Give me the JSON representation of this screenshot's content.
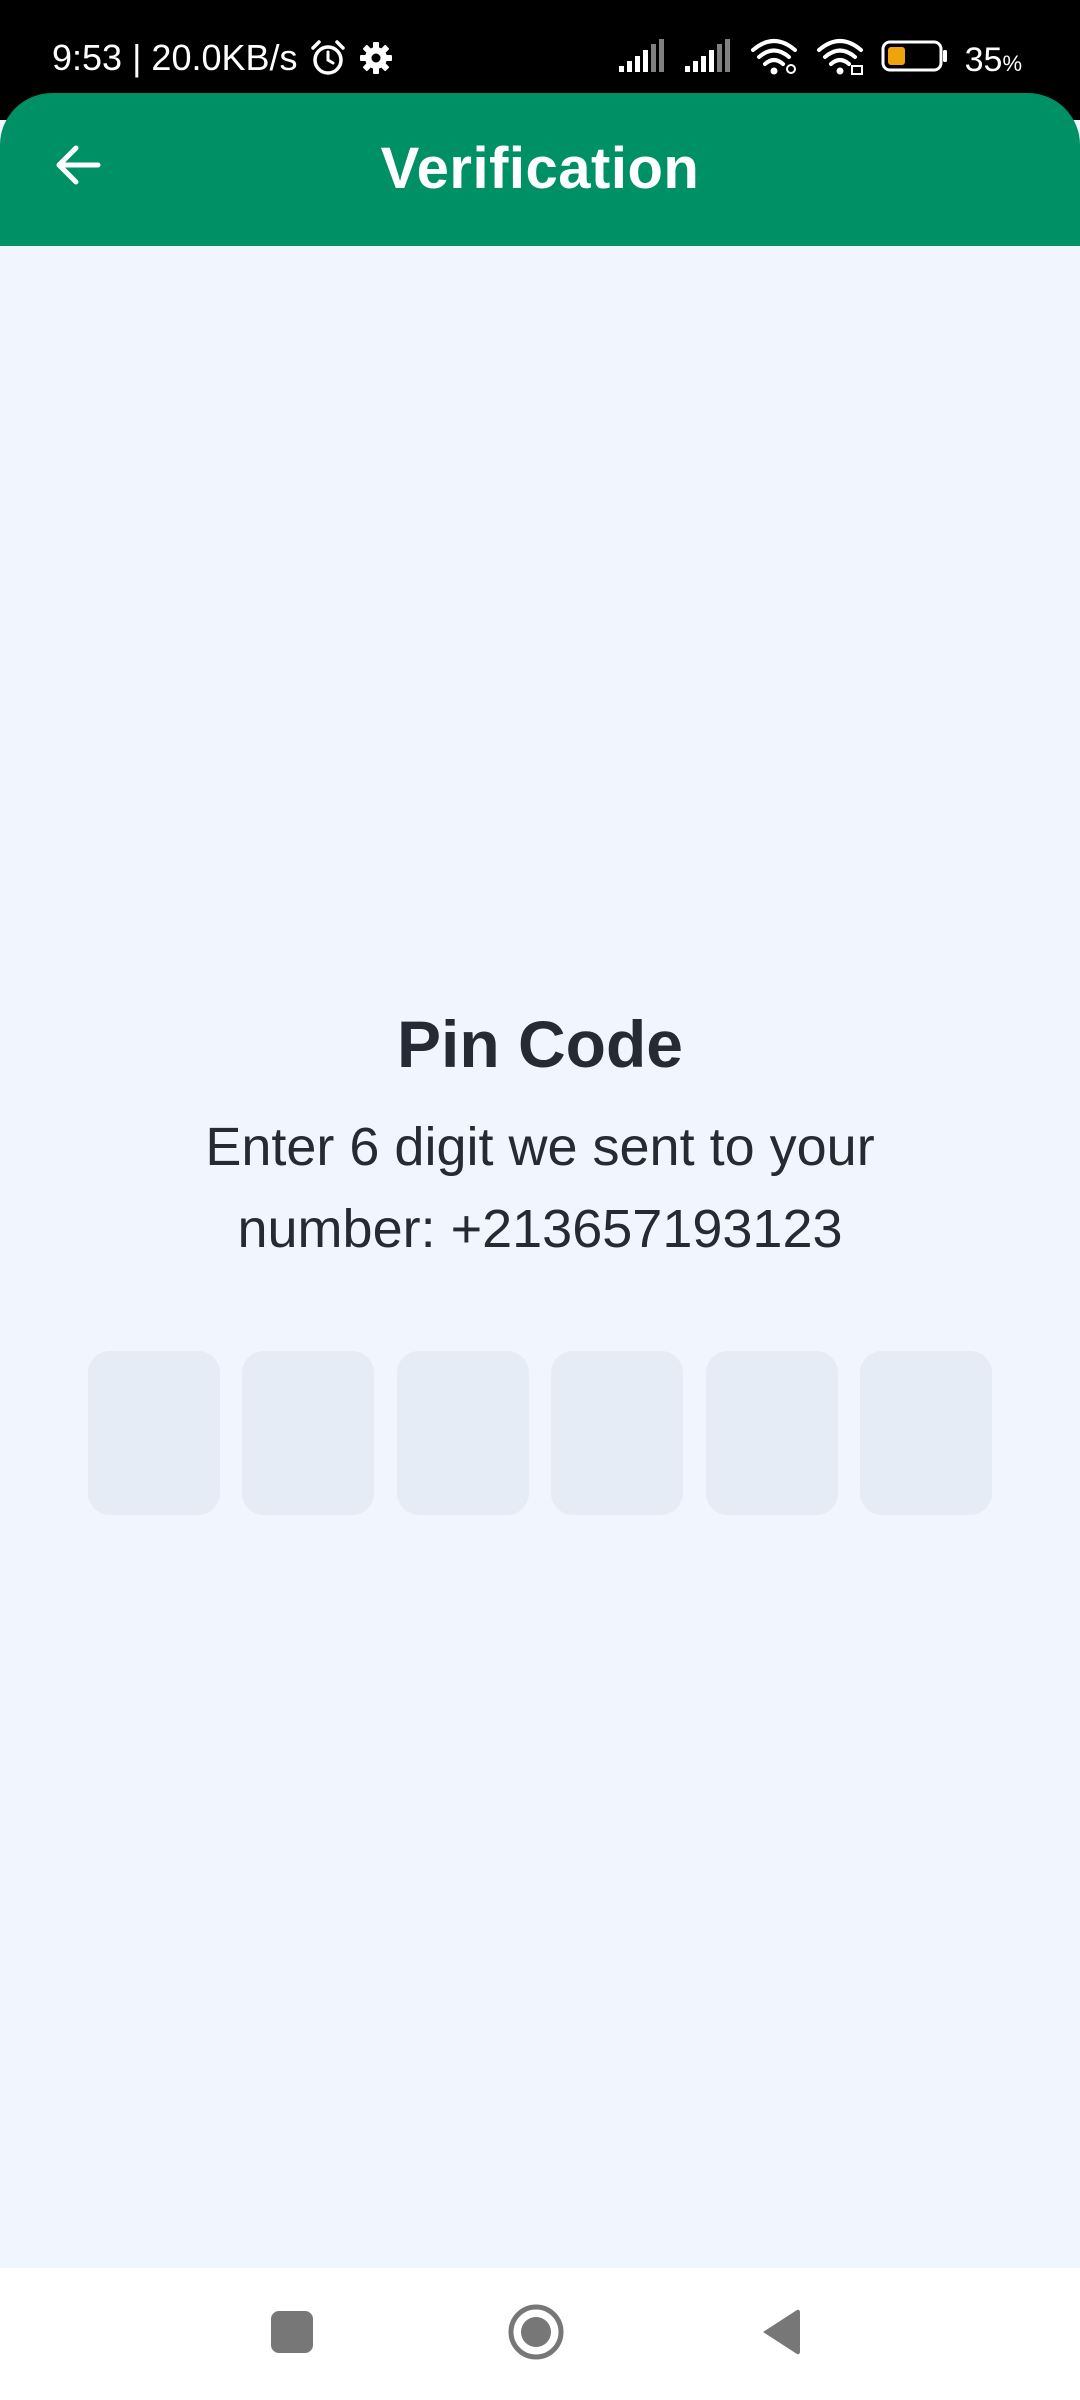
{
  "status_bar": {
    "time_speed": "9:53 | 20.0KB/s",
    "battery_percent": "35",
    "battery_percent_sign": "%",
    "battery_level": 0.35,
    "icons": [
      "alarm-icon",
      "gear-icon",
      "signal-icon",
      "signal-icon",
      "wifi-icon",
      "wifi-icon",
      "battery-icon"
    ]
  },
  "header": {
    "title": "Verification",
    "back_icon": "arrow-left-icon",
    "color": "#009066"
  },
  "main": {
    "title": "Pin Code",
    "subtitle_line1": "Enter 6 digit we sent to your",
    "subtitle_line2": "number: +213657193123",
    "pin_boxes": [
      "",
      "",
      "",
      "",
      "",
      ""
    ],
    "box_color": "#e5ecf6",
    "background_color": "#f1f5fe"
  },
  "nav_bar": {
    "icons": [
      "square-recents-icon",
      "circle-home-icon",
      "triangle-back-icon"
    ]
  }
}
